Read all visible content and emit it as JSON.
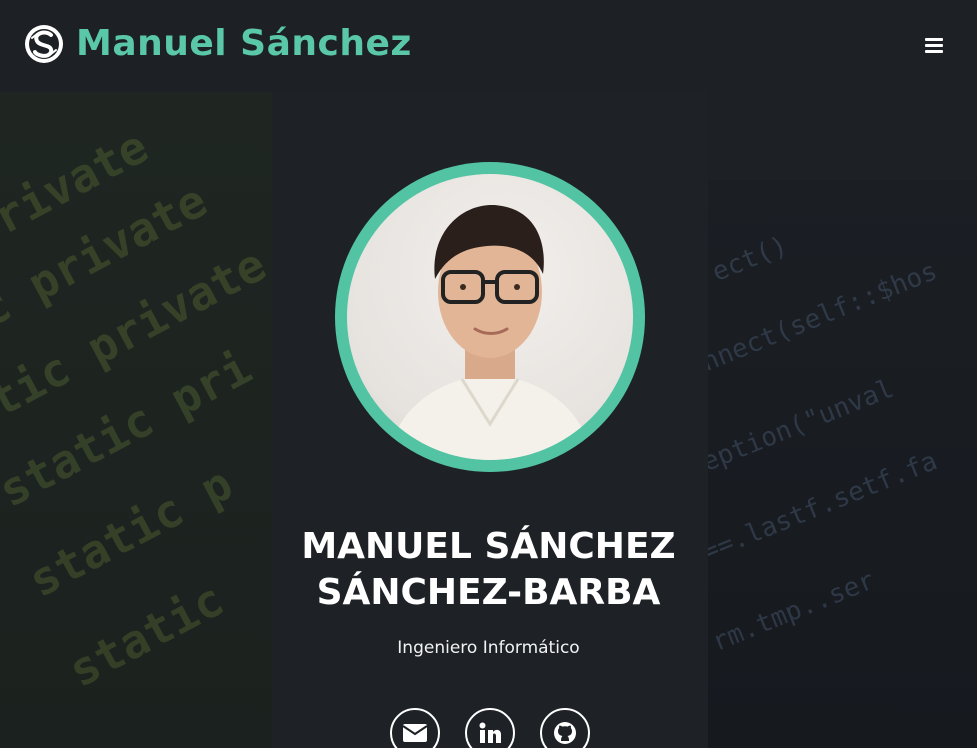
{
  "header": {
    "brand_name": "Manuel Sánchez",
    "logo_icon": "s-monogram-logo",
    "menu_icon": "hamburger-menu-icon"
  },
  "hero": {
    "avatar_alt": "Manuel Sánchez",
    "name_line1": "MANUEL SÁNCHEZ",
    "name_line2": "SÁNCHEZ-BARBA",
    "role": "Ingeniero Informático"
  },
  "socials": [
    {
      "icon": "envelope-icon",
      "label": "Email"
    },
    {
      "icon": "linkedin-icon",
      "label": "LinkedIn"
    },
    {
      "icon": "github-icon",
      "label": "GitHub"
    }
  ],
  "colors": {
    "accent": "#5ac8a8",
    "ring": "#52c4a4",
    "background": "#1d2125",
    "text": "#ffffff"
  }
}
